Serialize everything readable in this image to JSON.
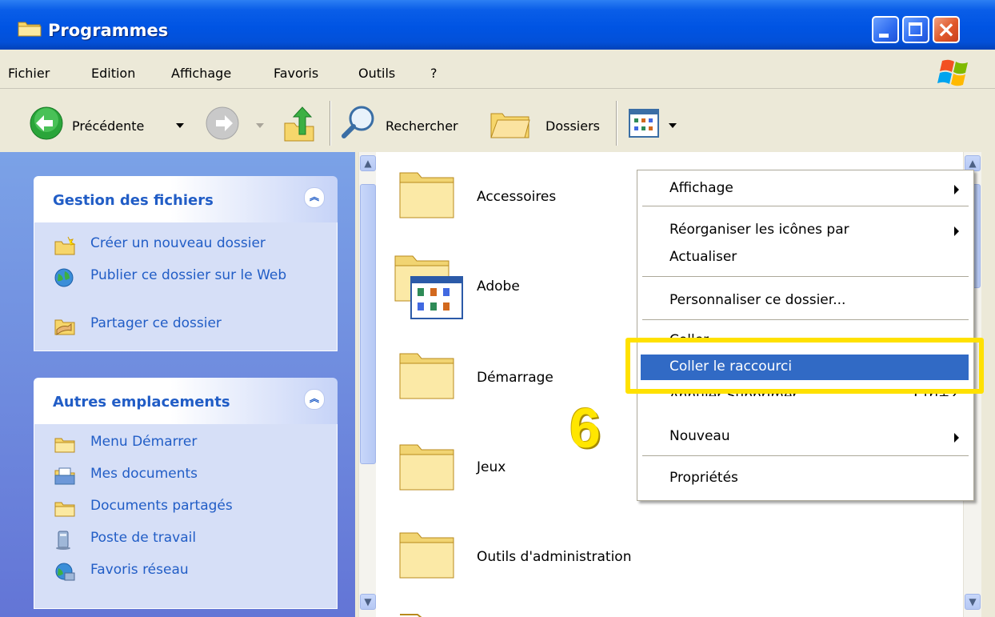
{
  "window": {
    "title": "Programmes"
  },
  "menu": [
    "Fichier",
    "Edition",
    "Affichage",
    "Favoris",
    "Outils",
    "?"
  ],
  "toolbar": {
    "back_label": "Précédente",
    "search_label": "Rechercher",
    "folders_label": "Dossiers"
  },
  "sidebar": {
    "file_tasks": {
      "title": "Gestion des fichiers",
      "items": [
        {
          "label": "Créer un nouveau dossier",
          "icon": "new-folder-icon"
        },
        {
          "label": "Publier ce dossier sur le Web",
          "icon": "publish-web-icon"
        },
        {
          "label": "Partager ce dossier",
          "icon": "share-folder-icon"
        }
      ]
    },
    "other_places": {
      "title": "Autres emplacements",
      "items": [
        {
          "label": "Menu Démarrer",
          "icon": "folder-icon"
        },
        {
          "label": "Mes documents",
          "icon": "my-documents-icon"
        },
        {
          "label": "Documents partagés",
          "icon": "folder-icon"
        },
        {
          "label": "Poste de travail",
          "icon": "computer-icon"
        },
        {
          "label": "Favoris réseau",
          "icon": "network-icon"
        }
      ]
    }
  },
  "files": [
    {
      "name": "Accessoires",
      "icon": "folder-icon"
    },
    {
      "name": "Adobe",
      "icon": "folder-program-icon"
    },
    {
      "name": "Démarrage",
      "icon": "folder-icon"
    },
    {
      "name": "Jeux",
      "icon": "folder-icon"
    },
    {
      "name": "Outils d'administration",
      "icon": "folder-icon"
    }
  ],
  "context_menu": {
    "items": [
      {
        "label": "Affichage",
        "submenu": true
      },
      {
        "label": "Réorganiser les icônes par",
        "submenu": true
      },
      {
        "label": "Actualiser"
      },
      {
        "label": "Personnaliser ce dossier..."
      },
      {
        "label": "Coller"
      },
      {
        "label": "Coller le raccourci",
        "highlighted": true
      },
      {
        "label": "Annuler Supprimer",
        "shortcut": "Ctrl+Z"
      },
      {
        "label": "Nouveau",
        "submenu": true
      },
      {
        "label": "Propriétés"
      }
    ]
  },
  "annotation": {
    "step": "6",
    "highlight_color": "#ffe100"
  },
  "colors": {
    "titlebar": "#0054e3",
    "sidebar": "#7ba2e7",
    "link": "#215dc6",
    "menu_highlight": "#316ac5"
  }
}
